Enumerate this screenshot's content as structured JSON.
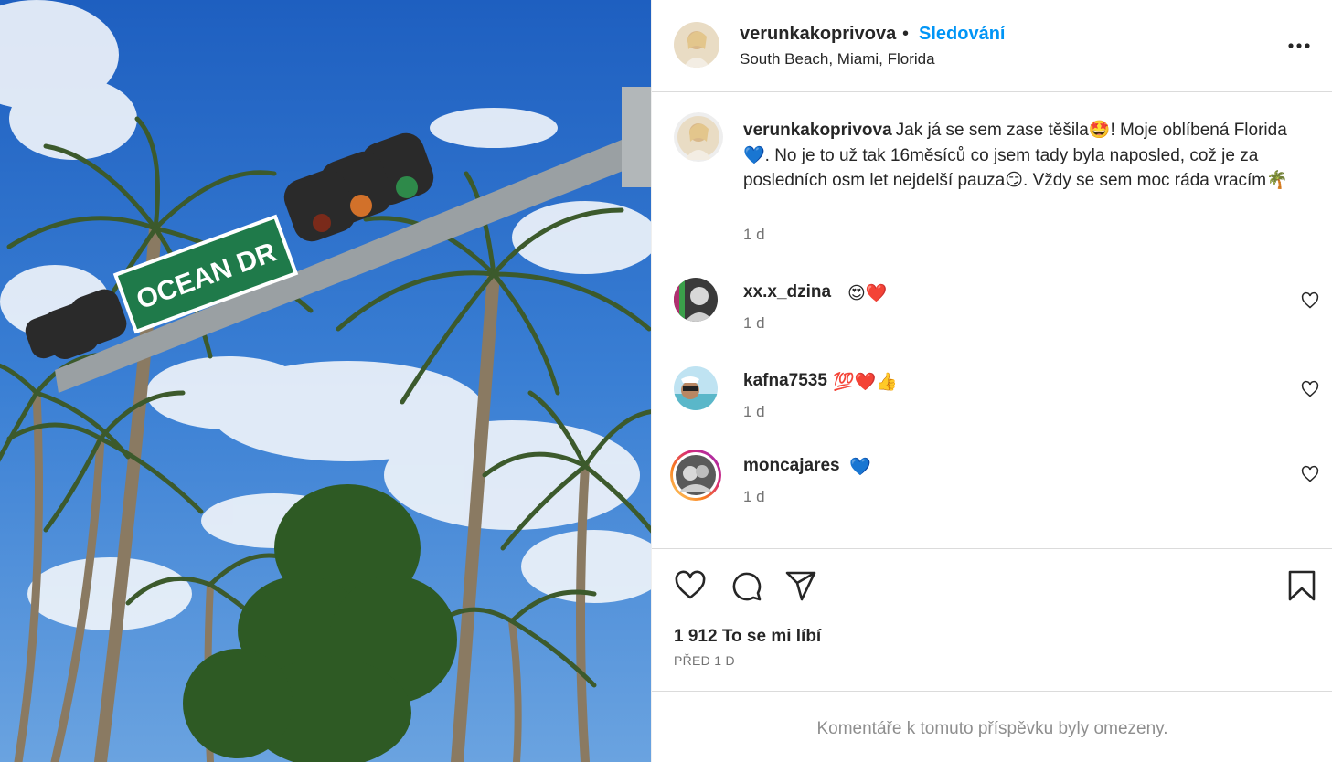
{
  "post": {
    "author": "verunkakoprivova",
    "follow_separator": "•",
    "follow_label": "Sledování",
    "location": "South Beach, Miami, Florida",
    "more_icon": "more-horizontal-icon",
    "photo": {
      "description_icon": "photo",
      "street_sign": "OCEAN DR"
    }
  },
  "caption": {
    "user": "verunkakoprivova",
    "text": "Jak já se sem zase těšila🤩! Moje oblíbená Florida💙. No je to už tak 16měsíců co jsem tady byla naposled, což je za posledních osm let nejdelší pauza😏. Vždy se sem moc ráda vracím🌴",
    "time": "1 d"
  },
  "comments": [
    {
      "user": "xx.x_dzina",
      "emoji": "😍❤️",
      "time": "1 d"
    },
    {
      "user": "kafna7535",
      "emoji": "💯❤️👍",
      "time": "1 d"
    },
    {
      "user": "moncajares",
      "emoji": "💙",
      "time": "1 d"
    }
  ],
  "actions": {
    "like_icon": "heart-icon",
    "comment_icon": "comment-icon",
    "share_icon": "share-icon",
    "save_icon": "bookmark-icon",
    "likes": "1 912 To se mi líbí",
    "ago": "PŘED 1 D"
  },
  "footer": {
    "restricted": "Komentáře k tomuto příspěvku byly omezeny."
  },
  "colors": {
    "accent": "#0095f6",
    "text": "#262626",
    "secondary": "#737373",
    "border": "#dbdbdb",
    "sign_green": "#1f7a4a",
    "sky": "#2f6fc9"
  }
}
